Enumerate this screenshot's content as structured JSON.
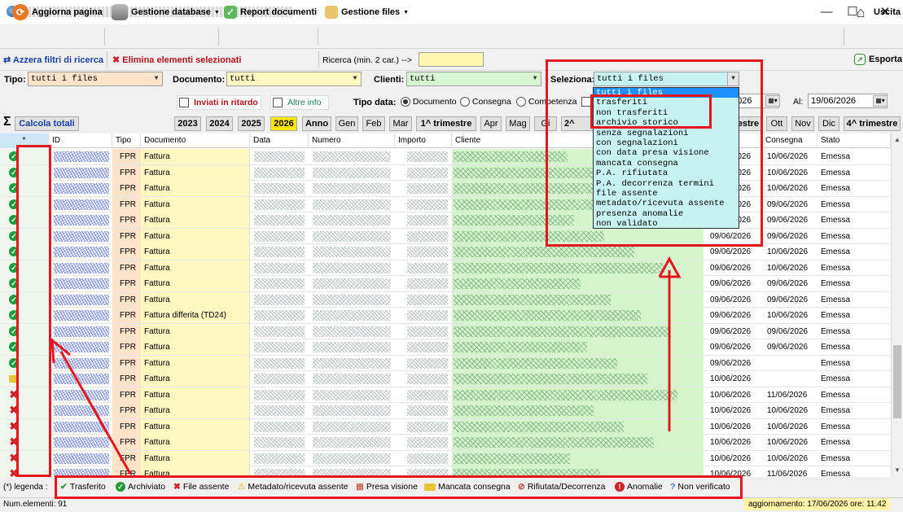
{
  "window": {
    "minimize": "—",
    "maximize": "☐",
    "close": "✕"
  },
  "toolbar": {
    "refresh": "Aggiorna pagina",
    "database": "Gestione database",
    "reports": "Report documenti",
    "files": "Gestione files",
    "exit": "Uscita"
  },
  "actions": {
    "reset_filters": "Azzera filtri di ricerca",
    "delete_selected": "Elimina elementi selezionati",
    "search_label": "Ricerca  (min. 2 car.) -->",
    "search_value": "",
    "export": "Esporta"
  },
  "filters": {
    "tipo_label": "Tipo:",
    "tipo_value": "tutti i files",
    "documento_label": "Documento:",
    "documento_value": "tutti",
    "clienti_label": "Clienti:",
    "clienti_value": "tutti",
    "seleziona_label": "Seleziona:",
    "seleziona_value": "tutti i files",
    "late_label": "Inviati in ritardo",
    "other_label": "Altre info",
    "date_type_label": "Tipo data:",
    "date_types": [
      "Documento",
      "Consegna",
      "Competenza"
    ],
    "date_from_value": "2026",
    "date_to_label": "Al:",
    "date_to_value": "19/06/2026"
  },
  "periods": {
    "calc": "Calcola totali",
    "buttons": [
      "2023",
      "2024",
      "2025",
      "2026",
      "Anno",
      "Gen",
      "Feb",
      "Mar",
      "1^ trimestre",
      "Apr",
      "Mag",
      "Gi",
      "2^ trim",
      "estre",
      "Ott",
      "Nov",
      "Dic",
      "4^ trimestre"
    ]
  },
  "dropdown_options": [
    "tutti i files",
    "trasferiti",
    "non trasferiti",
    "archivio storico",
    "senza segnalazioni",
    "con segnalazioni",
    "con data presa visione",
    "mancata consegna",
    "P.A. rifiutata",
    "P.A. decorrenza termini",
    "file assente",
    "metadato/ricevuta assente",
    "presenza anomalie",
    "non validato"
  ],
  "grid": {
    "headers": {
      "status": "*",
      "id": "ID",
      "tipo": "Tipo",
      "documento": "Documento",
      "data": "Data",
      "numero": "Numero",
      "importo": "Importo",
      "cliente": "Cliente",
      "consegna": "Consegna",
      "stato": "Stato"
    },
    "rows": [
      {
        "s": "ok",
        "tipo": "FPR",
        "doc": "Fattura",
        "dp": "09/06/2026",
        "cons": "10/06/2026",
        "stato": "Emessa"
      },
      {
        "s": "ok",
        "tipo": "FPR",
        "doc": "Fattura",
        "dp": "09/06/2026",
        "cons": "10/06/2026",
        "stato": "Emessa"
      },
      {
        "s": "ok",
        "tipo": "FPR",
        "doc": "Fattura",
        "dp": "09/06/2026",
        "cons": "10/06/2026",
        "stato": "Emessa"
      },
      {
        "s": "ok",
        "tipo": "FPR",
        "doc": "Fattura",
        "dp": "09/06/2026",
        "cons": "09/06/2026",
        "stato": "Emessa"
      },
      {
        "s": "ok",
        "tipo": "FPR",
        "doc": "Fattura",
        "dp": "09/06/2026",
        "cons": "09/06/2026",
        "stato": "Emessa"
      },
      {
        "s": "ok",
        "tipo": "FPR",
        "doc": "Fattura",
        "dp": "09/06/2026",
        "cons": "09/06/2026",
        "stato": "Emessa"
      },
      {
        "s": "ok",
        "tipo": "FPR",
        "doc": "Fattura",
        "dp": "09/06/2026",
        "cons": "10/06/2026",
        "stato": "Emessa"
      },
      {
        "s": "ok",
        "tipo": "FPR",
        "doc": "Fattura",
        "dp": "09/06/2026",
        "cons": "10/06/2026",
        "stato": "Emessa"
      },
      {
        "s": "ok",
        "tipo": "FPR",
        "doc": "Fattura",
        "dp": "09/06/2026",
        "cons": "09/06/2026",
        "stato": "Emessa"
      },
      {
        "s": "ok",
        "tipo": "FPR",
        "doc": "Fattura",
        "dp": "09/06/2026",
        "cons": "09/06/2026",
        "stato": "Emessa"
      },
      {
        "s": "ok",
        "tipo": "FPR",
        "doc": "Fattura differita (TD24)",
        "dp": "09/06/2026",
        "cons": "10/06/2026",
        "stato": "Emessa"
      },
      {
        "s": "ok",
        "tipo": "FPR",
        "doc": "Fattura",
        "dp": "09/06/2026",
        "cons": "09/06/2026",
        "stato": "Emessa"
      },
      {
        "s": "ok",
        "tipo": "FPR",
        "doc": "Fattura",
        "dp": "09/06/2026",
        "cons": "09/06/2026",
        "stato": "Emessa"
      },
      {
        "s": "ok",
        "tipo": "FPR",
        "doc": "Fattura",
        "dp": "09/06/2026",
        "cons": "",
        "stato": "Emessa"
      },
      {
        "s": "m",
        "tipo": "FPR",
        "doc": "Fattura",
        "dp": "10/06/2026",
        "cons": "",
        "stato": "Emessa"
      },
      {
        "s": "x",
        "tipo": "FPR",
        "doc": "Fattura",
        "dp": "10/06/2026",
        "cons": "11/06/2026",
        "stato": "Emessa"
      },
      {
        "s": "x",
        "tipo": "FPR",
        "doc": "Fattura",
        "dp": "10/06/2026",
        "cons": "10/06/2026",
        "stato": "Emessa"
      },
      {
        "s": "x",
        "tipo": "FPR",
        "doc": "Fattura",
        "dp": "10/06/2026",
        "cons": "10/06/2026",
        "stato": "Emessa"
      },
      {
        "s": "x",
        "tipo": "FPR",
        "doc": "Fattura",
        "dp": "10/06/2026",
        "cons": "10/06/2026",
        "stato": "Emessa"
      },
      {
        "s": "x",
        "tipo": "FPR",
        "doc": "Fattura",
        "dp": "10/06/2026",
        "cons": "10/06/2026",
        "stato": "Emessa"
      },
      {
        "s": "x",
        "tipo": "FPR",
        "doc": "Fattura",
        "dp": "10/06/2026",
        "cons": "11/06/2026",
        "stato": "Emessa"
      }
    ]
  },
  "legend": {
    "title": "(*) legenda :",
    "items": [
      "Trasferito",
      "Archiviato",
      "File assente",
      "Metadato/ricevuta assente",
      "Presa visione",
      "Mancata consegna",
      "Rifiutata/Decorrenza",
      "Anomalie",
      "Non verificato"
    ]
  },
  "status": {
    "count": "Num.elementi: 91",
    "updated": "aggiornamento: 17/06/2026  ore: 11.42"
  },
  "colors": {
    "accent_red": "#e5161d",
    "ok_green": "#1f9c3a",
    "period_selected": "#ffe700"
  }
}
